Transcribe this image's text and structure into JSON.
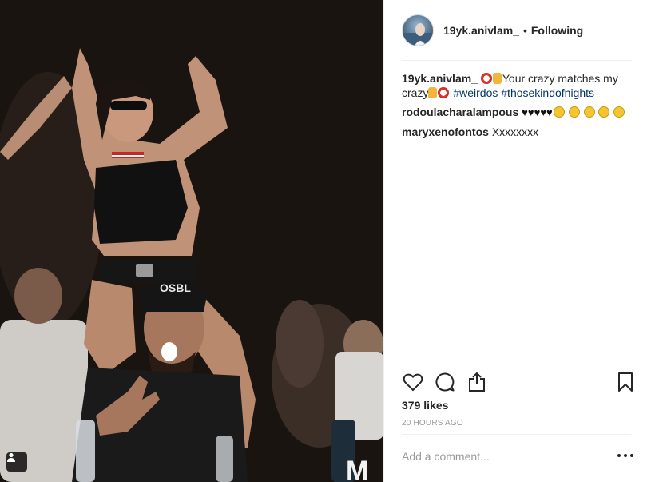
{
  "post": {
    "author": "19yk.anivlam_",
    "follow_status": "Following",
    "separator": "•"
  },
  "caption": {
    "user": "19yk.anivlam_",
    "text_1": "Your crazy matches my crazy",
    "hashtags": [
      "#weirdos",
      "#thosekindofnights"
    ]
  },
  "comments": [
    {
      "user": "rodoulacharalampous",
      "text": "♥♥♥♥♥"
    },
    {
      "user": "maryxenofontos",
      "text": "Xxxxxxxx"
    }
  ],
  "engagement": {
    "likes": "379 likes",
    "timestamp": "20 HOURS AGO"
  },
  "comment_input": {
    "placeholder": "Add a comment..."
  },
  "icons": {
    "like": "heart-icon",
    "comment": "comment-bubble-icon",
    "share": "share-icon",
    "save": "bookmark-icon",
    "more": "more-options-icon",
    "tagged": "user-tag-icon"
  },
  "colors": {
    "hashtag": "#003569",
    "text": "#262626",
    "muted": "#999999"
  }
}
